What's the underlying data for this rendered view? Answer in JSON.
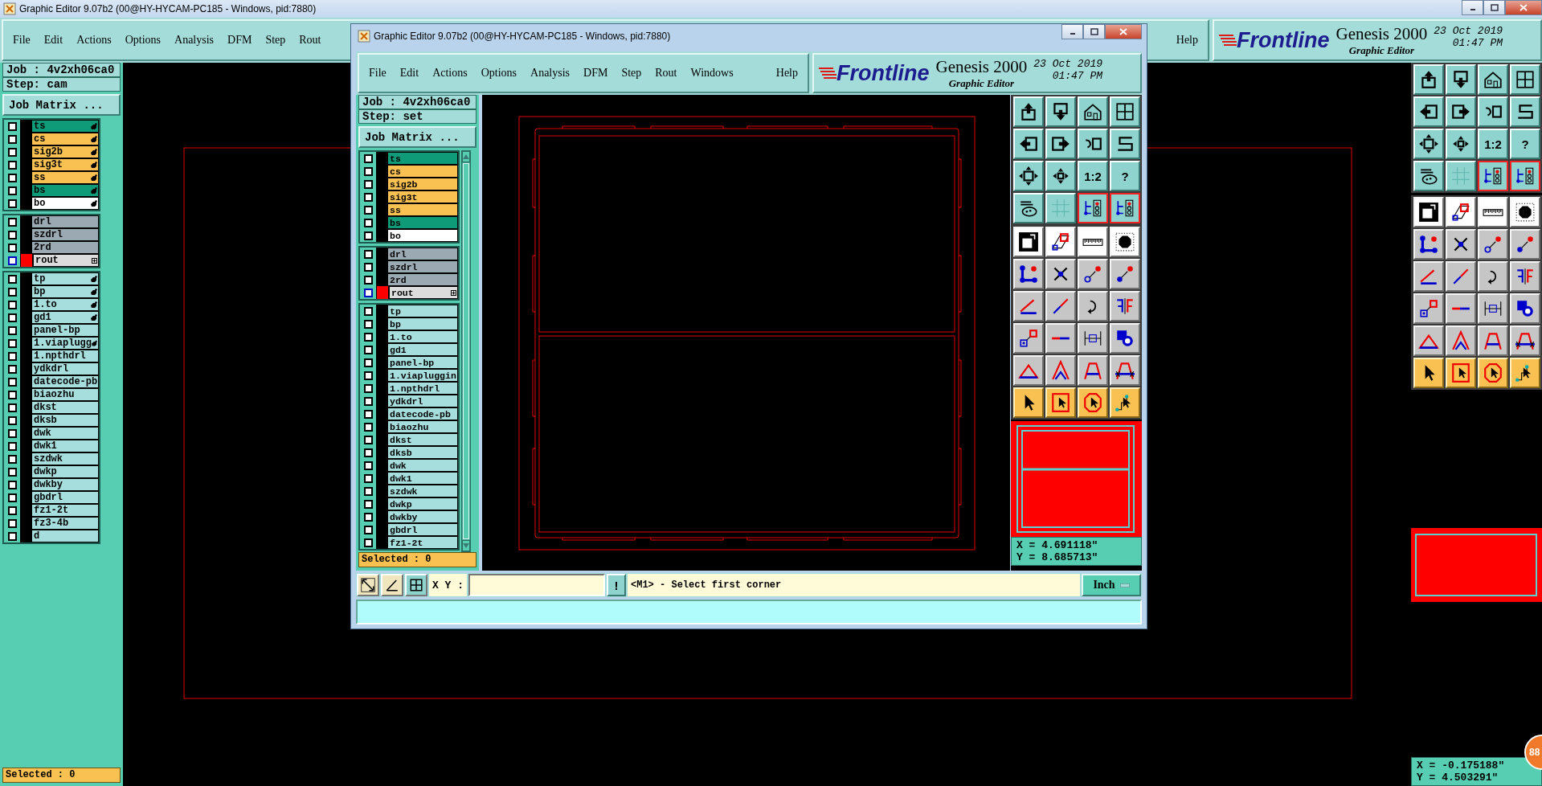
{
  "background_window": {
    "title": "Graphic Editor 9.07b2 (00@HY-HYCAM-PC185 - Windows, pid:7880)",
    "menu": [
      "File",
      "Edit",
      "Actions",
      "Options",
      "Analysis",
      "DFM",
      "Step",
      "Rout"
    ],
    "help": "Help",
    "brand": {
      "logo": "Frontline",
      "product": "Genesis 2000",
      "subtitle": "Graphic Editor",
      "date": "23 Oct 2019",
      "time": "01:47 PM"
    },
    "job": "Job : 4v2xh06ca0",
    "step": "Step: cam",
    "job_matrix_button": "Job Matrix ...",
    "layer_groups": [
      {
        "layers": [
          {
            "name": "ts",
            "color": "#0f9a78",
            "checked": false,
            "board": true,
            "work": false
          },
          {
            "name": "cs",
            "color": "#f9c152",
            "checked": false,
            "board": true,
            "work": false
          },
          {
            "name": "sig2b",
            "color": "#f9c152",
            "checked": false,
            "board": true,
            "work": false
          },
          {
            "name": "sig3t",
            "color": "#f9c152",
            "checked": false,
            "board": true,
            "work": false
          },
          {
            "name": "ss",
            "color": "#f9c152",
            "checked": false,
            "board": true,
            "work": false
          },
          {
            "name": "bs",
            "color": "#0f9a78",
            "checked": false,
            "board": true,
            "work": false
          },
          {
            "name": "bo",
            "color": "#ffffff",
            "checked": false,
            "board": true,
            "work": false
          }
        ]
      },
      {
        "layers": [
          {
            "name": "drl",
            "color": "#9ba9b2",
            "checked": false,
            "board": false,
            "work": false
          },
          {
            "name": "szdrl",
            "color": "#9ba9b2",
            "checked": false,
            "board": false,
            "work": false
          },
          {
            "name": "2rd",
            "color": "#9ba9b2",
            "checked": false,
            "board": false,
            "work": false
          },
          {
            "name": "rout",
            "color": "#dcdcdc",
            "checked": false,
            "board": false,
            "work": true
          }
        ]
      },
      {
        "layers": [
          {
            "name": "tp",
            "color": "#a6dede",
            "checked": false,
            "board": true,
            "work": false
          },
          {
            "name": "bp",
            "color": "#a6dede",
            "checked": false,
            "board": true,
            "work": false
          },
          {
            "name": "1.to",
            "color": "#a6dede",
            "checked": false,
            "board": true,
            "work": false
          },
          {
            "name": "gd1",
            "color": "#a6dede",
            "checked": false,
            "board": true,
            "work": false
          },
          {
            "name": "panel-bp",
            "color": "#a6dede",
            "checked": false,
            "board": false,
            "work": false
          },
          {
            "name": "1.viaplugg",
            "color": "#a6dede",
            "checked": false,
            "board": true,
            "work": false
          },
          {
            "name": "1.npthdrl",
            "color": "#a6dede",
            "checked": false,
            "board": false,
            "work": false
          },
          {
            "name": "ydkdrl",
            "color": "#a6dede",
            "checked": false,
            "board": false,
            "work": false
          },
          {
            "name": "datecode-pb",
            "color": "#a6dede",
            "checked": false,
            "board": false,
            "work": false
          },
          {
            "name": "biaozhu",
            "color": "#a6dede",
            "checked": false,
            "board": false,
            "work": false
          },
          {
            "name": "dkst",
            "color": "#a6dede",
            "checked": false,
            "board": false,
            "work": false
          },
          {
            "name": "dksb",
            "color": "#a6dede",
            "checked": false,
            "board": false,
            "work": false
          },
          {
            "name": "dwk",
            "color": "#a6dede",
            "checked": false,
            "board": false,
            "work": false
          },
          {
            "name": "dwk1",
            "color": "#a6dede",
            "checked": false,
            "board": false,
            "work": false
          },
          {
            "name": "szdwk",
            "color": "#a6dede",
            "checked": false,
            "board": false,
            "work": false
          },
          {
            "name": "dwkp",
            "color": "#a6dede",
            "checked": false,
            "board": false,
            "work": false
          },
          {
            "name": "dwkby",
            "color": "#a6dede",
            "checked": false,
            "board": false,
            "work": false
          },
          {
            "name": "gbdrl",
            "color": "#a6dede",
            "checked": false,
            "board": false,
            "work": false
          },
          {
            "name": "fz1-2t",
            "color": "#a6dede",
            "checked": false,
            "board": false,
            "work": false
          },
          {
            "name": "fz3-4b",
            "color": "#a6dede",
            "checked": false,
            "board": false,
            "work": false
          },
          {
            "name": "d",
            "color": "#a6dede",
            "checked": false,
            "board": false,
            "work": false
          }
        ]
      }
    ],
    "selected": "Selected : 0",
    "tool_labels": [
      "1:2",
      "?"
    ],
    "coordinates": [
      "X = -0.175188\"",
      "Y = 4.503291\""
    ]
  },
  "front_window": {
    "title": "Graphic Editor 9.07b2 (00@HY-HYCAM-PC185 - Windows, pid:7880)",
    "menu": [
      "File",
      "Edit",
      "Actions",
      "Options",
      "Analysis",
      "DFM",
      "Step",
      "Rout",
      "Windows"
    ],
    "help": "Help",
    "brand": {
      "logo": "Frontline",
      "product": "Genesis 2000",
      "subtitle": "Graphic Editor",
      "date": "23 Oct 2019",
      "time": "01:47 PM"
    },
    "job": "Job : 4v2xh06ca0",
    "step": "Step: set",
    "job_matrix_button": "Job Matrix ...",
    "layer_groups": [
      {
        "layers": [
          {
            "name": "ts",
            "color": "#0f9a78",
            "checked": false,
            "work": false
          },
          {
            "name": "cs",
            "color": "#f9c152",
            "checked": false,
            "work": false
          },
          {
            "name": "sig2b",
            "color": "#f9c152",
            "checked": false,
            "work": false
          },
          {
            "name": "sig3t",
            "color": "#f9c152",
            "checked": false,
            "work": false
          },
          {
            "name": "ss",
            "color": "#f9c152",
            "checked": false,
            "work": false
          },
          {
            "name": "bs",
            "color": "#0f9a78",
            "checked": false,
            "work": false
          },
          {
            "name": "bo",
            "color": "#ffffff",
            "checked": false,
            "work": false
          }
        ]
      },
      {
        "layers": [
          {
            "name": "drl",
            "color": "#9ba9b2",
            "checked": false,
            "work": false
          },
          {
            "name": "szdrl",
            "color": "#9ba9b2",
            "checked": false,
            "work": false
          },
          {
            "name": "2rd",
            "color": "#9ba9b2",
            "checked": false,
            "work": false
          },
          {
            "name": "rout",
            "color": "#dcdcdc",
            "checked": false,
            "work": true
          }
        ]
      },
      {
        "layers": [
          {
            "name": "tp",
            "color": "#a6dede",
            "checked": false,
            "work": false
          },
          {
            "name": "bp",
            "color": "#a6dede",
            "checked": false,
            "work": false
          },
          {
            "name": "1.to",
            "color": "#a6dede",
            "checked": false,
            "work": false
          },
          {
            "name": "gd1",
            "color": "#a6dede",
            "checked": false,
            "work": false
          },
          {
            "name": "panel-bp",
            "color": "#a6dede",
            "checked": false,
            "work": false
          },
          {
            "name": "1.viapluggin",
            "color": "#a6dede",
            "checked": false,
            "work": false
          },
          {
            "name": "1.npthdrl",
            "color": "#a6dede",
            "checked": false,
            "work": false
          },
          {
            "name": "ydkdrl",
            "color": "#a6dede",
            "checked": false,
            "work": false
          },
          {
            "name": "datecode-pb",
            "color": "#a6dede",
            "checked": false,
            "work": false
          },
          {
            "name": "biaozhu",
            "color": "#a6dede",
            "checked": false,
            "work": false
          },
          {
            "name": "dkst",
            "color": "#a6dede",
            "checked": false,
            "work": false
          },
          {
            "name": "dksb",
            "color": "#a6dede",
            "checked": false,
            "work": false
          },
          {
            "name": "dwk",
            "color": "#a6dede",
            "checked": false,
            "work": false
          },
          {
            "name": "dwk1",
            "color": "#a6dede",
            "checked": false,
            "work": false
          },
          {
            "name": "szdwk",
            "color": "#a6dede",
            "checked": false,
            "work": false
          },
          {
            "name": "dwkp",
            "color": "#a6dede",
            "checked": false,
            "work": false
          },
          {
            "name": "dwkby",
            "color": "#a6dede",
            "checked": false,
            "work": false
          },
          {
            "name": "gbdrl",
            "color": "#a6dede",
            "checked": false,
            "work": false
          },
          {
            "name": "fz1-2t",
            "color": "#a6dede",
            "checked": false,
            "work": false
          }
        ]
      }
    ],
    "selected": "Selected : 0",
    "tool_labels": [
      "1:2",
      "?"
    ],
    "coordinates": [
      "X = 4.691118\"",
      "Y = 8.685713\""
    ],
    "prompt_bar": {
      "xy_label": "X Y :",
      "alert_button": "!",
      "prompt": "<M1> - Select first corner",
      "units": "Inch"
    }
  },
  "notification_badge": "88"
}
